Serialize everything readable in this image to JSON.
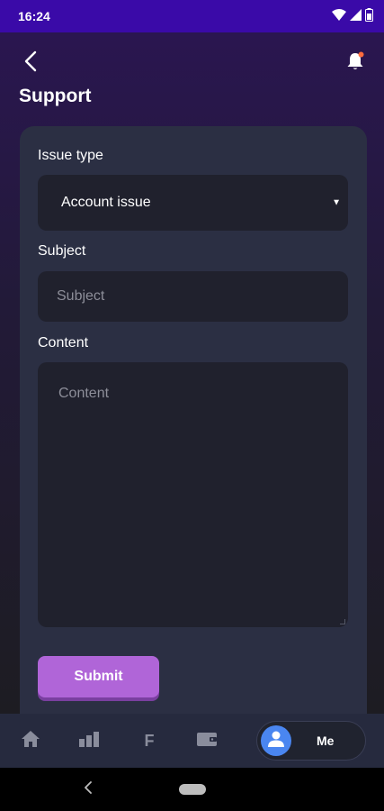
{
  "status_bar": {
    "time": "16:24",
    "icons": [
      "wifi-icon",
      "signal-icon",
      "battery-icon"
    ]
  },
  "header": {
    "back_icon": "chevron-left-icon",
    "notification_icon": "bell-icon",
    "title": "Support"
  },
  "form": {
    "issue_type": {
      "label": "Issue type",
      "selected": "Account issue"
    },
    "subject": {
      "label": "Subject",
      "placeholder": "Subject",
      "value": ""
    },
    "content": {
      "label": "Content",
      "placeholder": "Content",
      "value": ""
    },
    "submit_label": "Submit"
  },
  "bottom_nav": {
    "items": [
      {
        "icon": "home-icon"
      },
      {
        "icon": "bar-chart-icon"
      },
      {
        "text": "F"
      },
      {
        "icon": "wallet-icon"
      },
      {
        "icon": "user-icon",
        "label": "Me",
        "active": true
      }
    ]
  },
  "colors": {
    "accent": "#b065d8",
    "status_bar": "#3a0aa8",
    "card": "#2b2f43",
    "field": "#20212d",
    "nav": "#262a3e",
    "avatar": "#4a86f0",
    "notification_dot": "#ff6b3d"
  }
}
